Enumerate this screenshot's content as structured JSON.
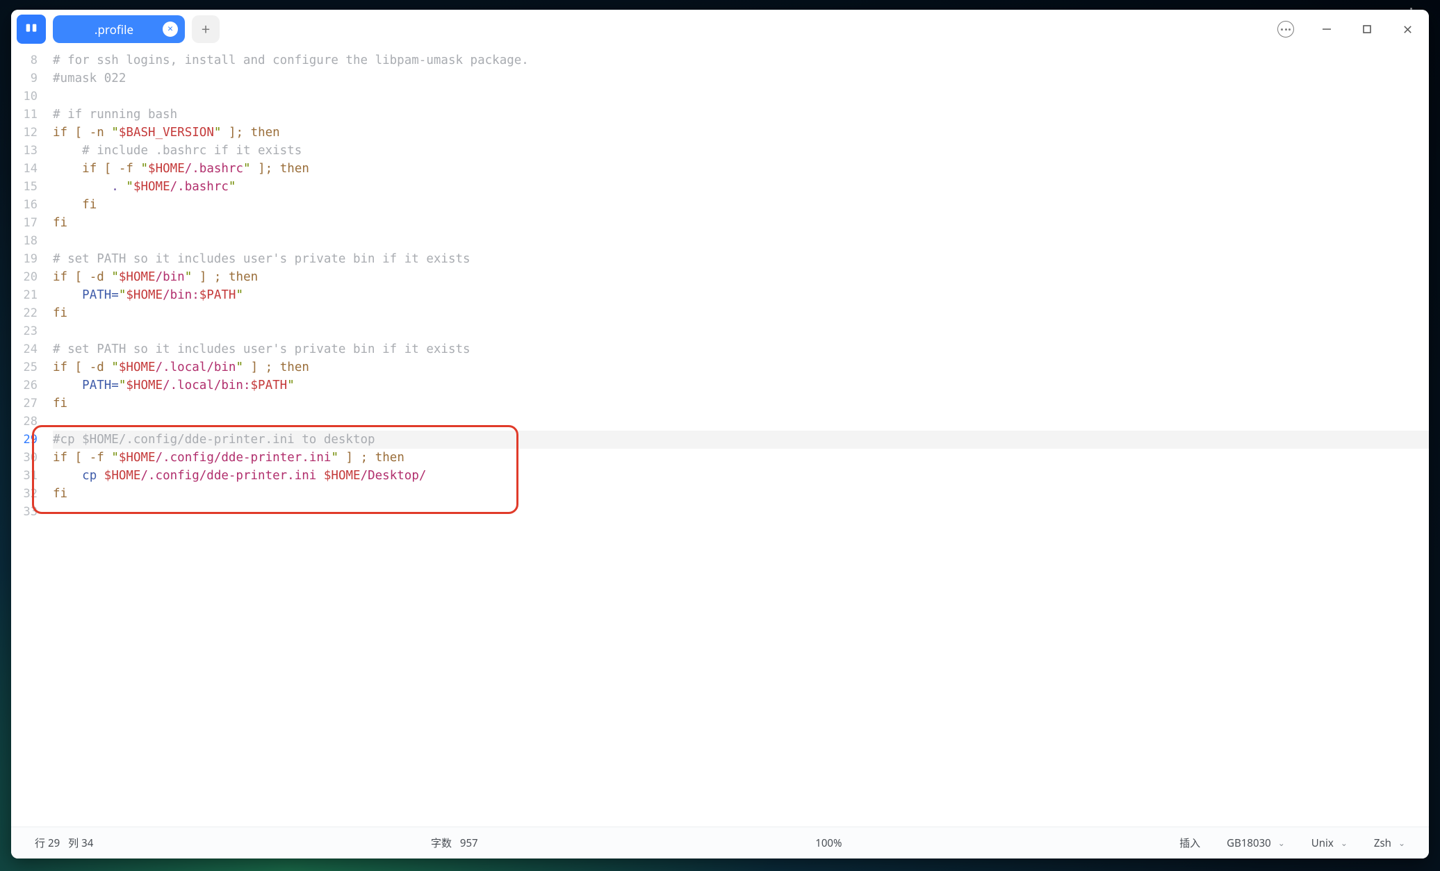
{
  "titlebar": {
    "app_glyph": "\"",
    "tab_label": ".profile",
    "tab_close": "×",
    "newtab": "+"
  },
  "editor": {
    "first_line": 8,
    "current_line": 29,
    "lines": [
      {
        "n": 8,
        "html": "<span class='tok-comment'># for ssh logins, install and configure the libpam-umask package.</span>"
      },
      {
        "n": 9,
        "html": "<span class='tok-comment'>#umask 022</span>"
      },
      {
        "n": 10,
        "html": ""
      },
      {
        "n": 11,
        "html": "<span class='tok-comment'># if running bash</span>"
      },
      {
        "n": 12,
        "html": "<span class='tok-kw'>if</span> <span class='tok-key'>[</span> <span class='tok-key'>-n</span> <span class='tok-str'>&quot;</span><span class='tok-var'>$BASH_VERSION</span><span class='tok-str'>&quot;</span> <span class='tok-key'>];</span> <span class='tok-kw'>then</span>"
      },
      {
        "n": 13,
        "html": "    <span class='tok-comment'># include .bashrc if it exists</span>"
      },
      {
        "n": 14,
        "html": "    <span class='tok-kw'>if</span> <span class='tok-key'>[</span> <span class='tok-key'>-f</span> <span class='tok-str'>&quot;</span><span class='tok-var'>$HOME</span><span class='tok-path'>/.bashrc</span><span class='tok-str'>&quot;</span> <span class='tok-key'>];</span> <span class='tok-kw'>then</span>"
      },
      {
        "n": 15,
        "html": "        <span class='tok-dot'>.</span> <span class='tok-str'>&quot;</span><span class='tok-var'>$HOME</span><span class='tok-path'>/.bashrc</span><span class='tok-str'>&quot;</span>"
      },
      {
        "n": 16,
        "html": "    <span class='tok-kw'>fi</span>"
      },
      {
        "n": 17,
        "html": "<span class='tok-kw'>fi</span>"
      },
      {
        "n": 18,
        "html": ""
      },
      {
        "n": 19,
        "html": "<span class='tok-comment'># set PATH so it includes user's private bin if it exists</span>"
      },
      {
        "n": 20,
        "html": "<span class='tok-kw'>if</span> <span class='tok-key'>[</span> <span class='tok-key'>-d</span> <span class='tok-str'>&quot;</span><span class='tok-var'>$HOME</span><span class='tok-path'>/bin</span><span class='tok-str'>&quot;</span> <span class='tok-key'>]</span> <span class='tok-key'>;</span> <span class='tok-kw'>then</span>"
      },
      {
        "n": 21,
        "html": "    <span class='tok-cmd'>PATH=</span><span class='tok-str'>&quot;</span><span class='tok-var'>$HOME</span><span class='tok-path'>/bin:</span><span class='tok-var'>$PATH</span><span class='tok-str'>&quot;</span>"
      },
      {
        "n": 22,
        "html": "<span class='tok-kw'>fi</span>"
      },
      {
        "n": 23,
        "html": ""
      },
      {
        "n": 24,
        "html": "<span class='tok-comment'># set PATH so it includes user's private bin if it exists</span>"
      },
      {
        "n": 25,
        "html": "<span class='tok-kw'>if</span> <span class='tok-key'>[</span> <span class='tok-key'>-d</span> <span class='tok-str'>&quot;</span><span class='tok-var'>$HOME</span><span class='tok-path'>/.local/bin</span><span class='tok-str'>&quot;</span> <span class='tok-key'>]</span> <span class='tok-key'>;</span> <span class='tok-kw'>then</span>"
      },
      {
        "n": 26,
        "html": "    <span class='tok-cmd'>PATH=</span><span class='tok-str'>&quot;</span><span class='tok-var'>$HOME</span><span class='tok-path'>/.local/bin:</span><span class='tok-var'>$PATH</span><span class='tok-str'>&quot;</span>"
      },
      {
        "n": 27,
        "html": "<span class='tok-kw'>fi</span>"
      },
      {
        "n": 28,
        "html": ""
      },
      {
        "n": 29,
        "html": "<span class='tok-comment'>#cp $HOME/.config/dde-printer.ini to desktop</span>"
      },
      {
        "n": 30,
        "html": "<span class='tok-kw'>if</span> <span class='tok-key'>[</span> <span class='tok-key'>-f</span> <span class='tok-str'>&quot;</span><span class='tok-var'>$HOME</span><span class='tok-path'>/.config/dde-printer.ini</span><span class='tok-str'>&quot;</span> <span class='tok-key'>]</span> <span class='tok-key'>;</span> <span class='tok-kw'>then</span>"
      },
      {
        "n": 31,
        "html": "    <span class='tok-cmd'>cp</span> <span class='tok-var'>$HOME</span><span class='tok-path'>/.config/dde-printer.ini</span> <span class='tok-var'>$HOME</span><span class='tok-path'>/Desktop/</span>"
      },
      {
        "n": 32,
        "html": "<span class='tok-kw'>fi</span>"
      },
      {
        "n": 33,
        "html": ""
      }
    ],
    "highlight": {
      "start": 29,
      "end": 32
    }
  },
  "statusbar": {
    "pos_label_row": "行",
    "pos_row": "29",
    "pos_label_col": "列",
    "pos_col": "34",
    "chars_label": "字数",
    "chars_value": "957",
    "zoom": "100%",
    "mode": "插入",
    "encoding": "GB18030",
    "line_ending": "Unix",
    "language": "Zsh"
  }
}
